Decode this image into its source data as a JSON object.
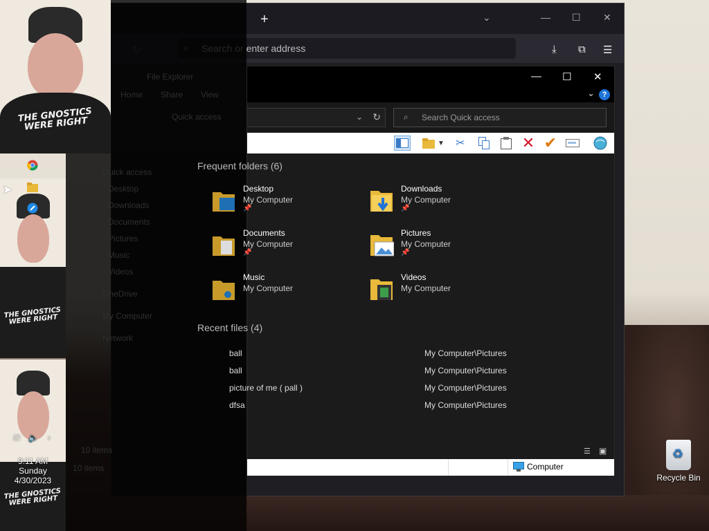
{
  "browser": {
    "new_tab": "+",
    "address_placeholder": "Search or enter address"
  },
  "ghost_explorer": {
    "title": "File Explorer",
    "tab_home": "Home",
    "tab_share": "Share",
    "tab_view": "View",
    "address": "Quick access",
    "nav": [
      "Quick access",
      "Desktop",
      "Downloads",
      "Documents",
      "Pictures",
      "Music",
      "Videos",
      "OneDrive",
      "My Computer",
      "Network"
    ],
    "items_count": "10 items",
    "status_items": "10 items"
  },
  "explorer": {
    "search_placeholder": "Search Quick access",
    "help": "?",
    "frequent_title": "Frequent folders (6)",
    "folders": [
      {
        "name": "Desktop",
        "location": "My Computer",
        "pinned": true
      },
      {
        "name": "Downloads",
        "location": "My Computer",
        "pinned": true
      },
      {
        "name": "Documents",
        "location": "My Computer",
        "pinned": true
      },
      {
        "name": "Pictures",
        "location": "My Computer",
        "pinned": true
      },
      {
        "name": "Music",
        "location": "My Computer",
        "pinned": false
      },
      {
        "name": "Videos",
        "location": "My Computer",
        "pinned": false
      }
    ],
    "recent_title": "Recent files (4)",
    "recent": [
      {
        "name": "ball",
        "path": "My Computer\\Pictures"
      },
      {
        "name": "ball",
        "path": "My Computer\\Pictures"
      },
      {
        "name": "picture of me ( pall )",
        "path": "My Computer\\Pictures"
      },
      {
        "name": "dfsa",
        "path": "My Computer\\Pictures"
      }
    ],
    "status_computer": "Computer"
  },
  "tray": {
    "time": "9:11 AM",
    "day": "Sunday",
    "date": "4/30/2023"
  },
  "desktop": {
    "recycle_bin": "Recycle Bin"
  },
  "webcam": {
    "slogan_line1": "THE GNOSTICS",
    "slogan_line2": "WERE RIGHT"
  },
  "colors": {
    "accent_blue": "#1e73d8",
    "folder_yellow": "#e8b93a",
    "delete_red": "#d0142a",
    "check_orange": "#e07a12"
  }
}
